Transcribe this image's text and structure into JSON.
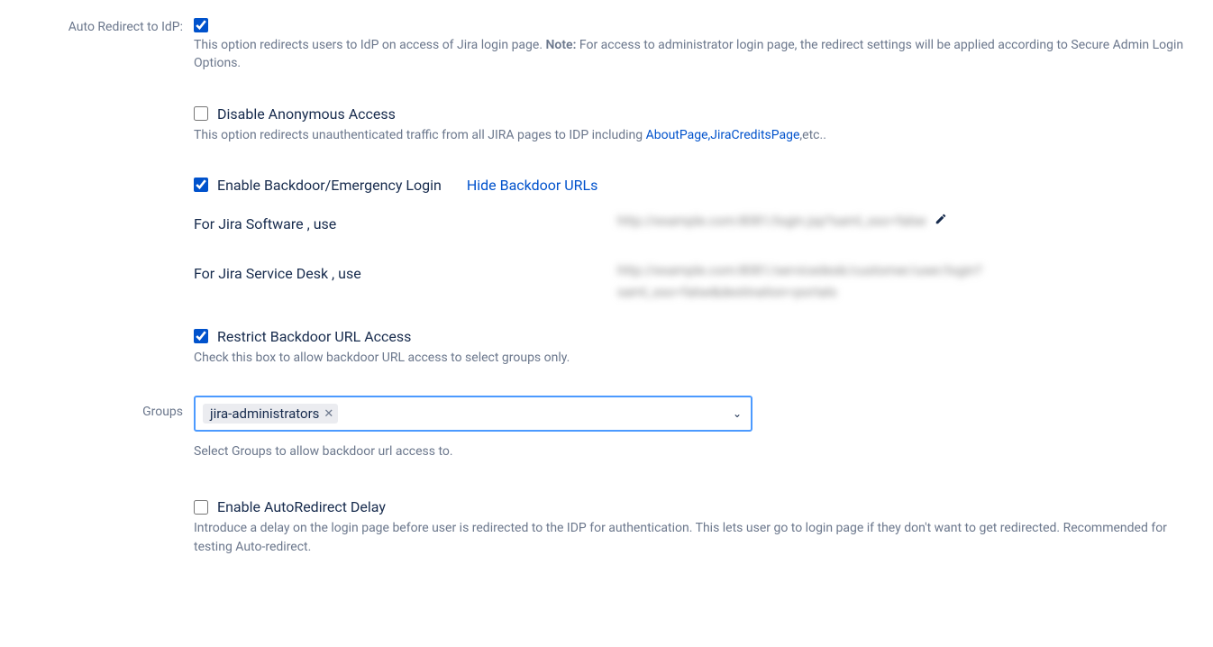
{
  "autoRedirect": {
    "label": "Auto Redirect to IdP:",
    "help_pre": "This option redirects users to IdP on access of Jira login page. ",
    "help_note": "Note:",
    "help_post": " For access to administrator login page, the redirect settings will be applied according to Secure Admin Login Options."
  },
  "disableAnon": {
    "label": "Disable Anonymous Access",
    "help_pre": "This option redirects unauthenticated traffic from all JIRA pages to IDP including ",
    "links": "AboutPage,JiraCreditsPage",
    "help_post": ",etc.."
  },
  "backdoor": {
    "label": "Enable Backdoor/Emergency Login",
    "hide_link": "Hide Backdoor URLs",
    "sw_label": "For Jira Software , use",
    "sw_url": "http://example.com:8081/login.jsp?saml_sso=false",
    "sd_label": "For Jira Service Desk , use",
    "sd_url": "http://example.com:8081/servicedesk/customer/user/login?saml_sso=false&destination=portals"
  },
  "restrict": {
    "label": "Restrict Backdoor URL Access",
    "help": "Check this box to allow backdoor URL access to select groups only."
  },
  "groups": {
    "label": "Groups",
    "chip": "jira-administrators",
    "help": "Select Groups to allow backdoor url access to."
  },
  "delay": {
    "label": "Enable AutoRedirect Delay",
    "help": "Introduce a delay on the login page before user is redirected to the IDP for authentication. This lets user go to login page if they don't want to get redirected. Recommended for testing Auto-redirect."
  }
}
